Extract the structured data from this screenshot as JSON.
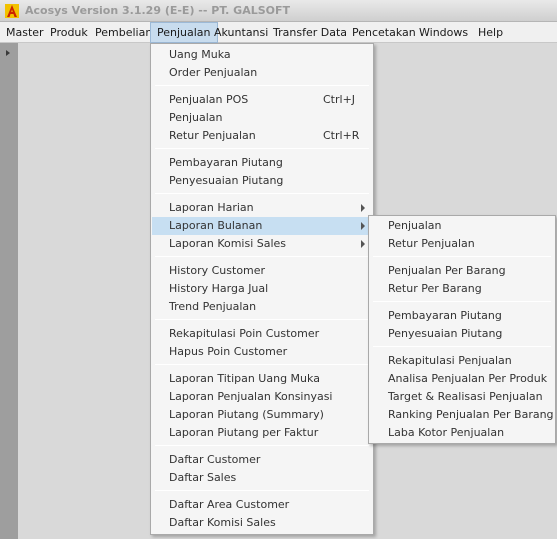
{
  "window": {
    "title": "Acosys Version 3.1.29 (E-E) -- PT. GALSOFT"
  },
  "menubar": {
    "items": [
      {
        "label": "Master"
      },
      {
        "label": "Produk"
      },
      {
        "label": "Pembelian"
      },
      {
        "label": "Penjualan"
      },
      {
        "label": "Akuntansi"
      },
      {
        "label": "Transfer Data"
      },
      {
        "label": "Pencetakan"
      },
      {
        "label": "Windows"
      },
      {
        "label": "Help"
      }
    ]
  },
  "penjualan_menu": {
    "items": [
      {
        "label": "Uang Muka"
      },
      {
        "label": "Order Penjualan"
      },
      {
        "label": "Penjualan POS",
        "shortcut": "Ctrl+J"
      },
      {
        "label": "Penjualan"
      },
      {
        "label": "Retur Penjualan",
        "shortcut": "Ctrl+R"
      },
      {
        "label": "Pembayaran Piutang"
      },
      {
        "label": "Penyesuaian Piutang"
      },
      {
        "label": "Laporan Harian"
      },
      {
        "label": "Laporan Bulanan"
      },
      {
        "label": "Laporan Komisi Sales"
      },
      {
        "label": "History Customer"
      },
      {
        "label": "History Harga Jual"
      },
      {
        "label": "Trend Penjualan"
      },
      {
        "label": "Rekapitulasi Poin Customer"
      },
      {
        "label": "Hapus Poin Customer"
      },
      {
        "label": "Laporan Titipan Uang Muka"
      },
      {
        "label": "Laporan Penjualan Konsinyasi"
      },
      {
        "label": "Laporan Piutang (Summary)"
      },
      {
        "label": "Laporan Piutang per Faktur"
      },
      {
        "label": "Daftar Customer"
      },
      {
        "label": "Daftar Sales"
      },
      {
        "label": "Daftar Area Customer"
      },
      {
        "label": "Daftar Komisi Sales"
      }
    ]
  },
  "laporan_bulanan_menu": {
    "items": [
      {
        "label": "Penjualan"
      },
      {
        "label": "Retur Penjualan"
      },
      {
        "label": "Penjualan Per Barang"
      },
      {
        "label": "Retur Per Barang"
      },
      {
        "label": "Pembayaran Piutang"
      },
      {
        "label": "Penyesuaian Piutang"
      },
      {
        "label": "Rekapitulasi Penjualan"
      },
      {
        "label": "Analisa Penjualan Per Produk"
      },
      {
        "label": "Target & Realisasi Penjualan"
      },
      {
        "label": "Ranking Penjualan Per Barang"
      },
      {
        "label": "Laba Kotor Penjualan"
      }
    ]
  },
  "icons": {
    "app": "acosys-logo-icon",
    "submenu": "submenu-arrow-icon",
    "strip": "collapse-arrow-icon"
  },
  "colors": {
    "menu_highlight": "#c7dff2",
    "menubar_active": "#c8dcee",
    "workspace": "#d9d9d9",
    "logo_red": "#cc2200",
    "logo_yellow": "#f2c200"
  }
}
